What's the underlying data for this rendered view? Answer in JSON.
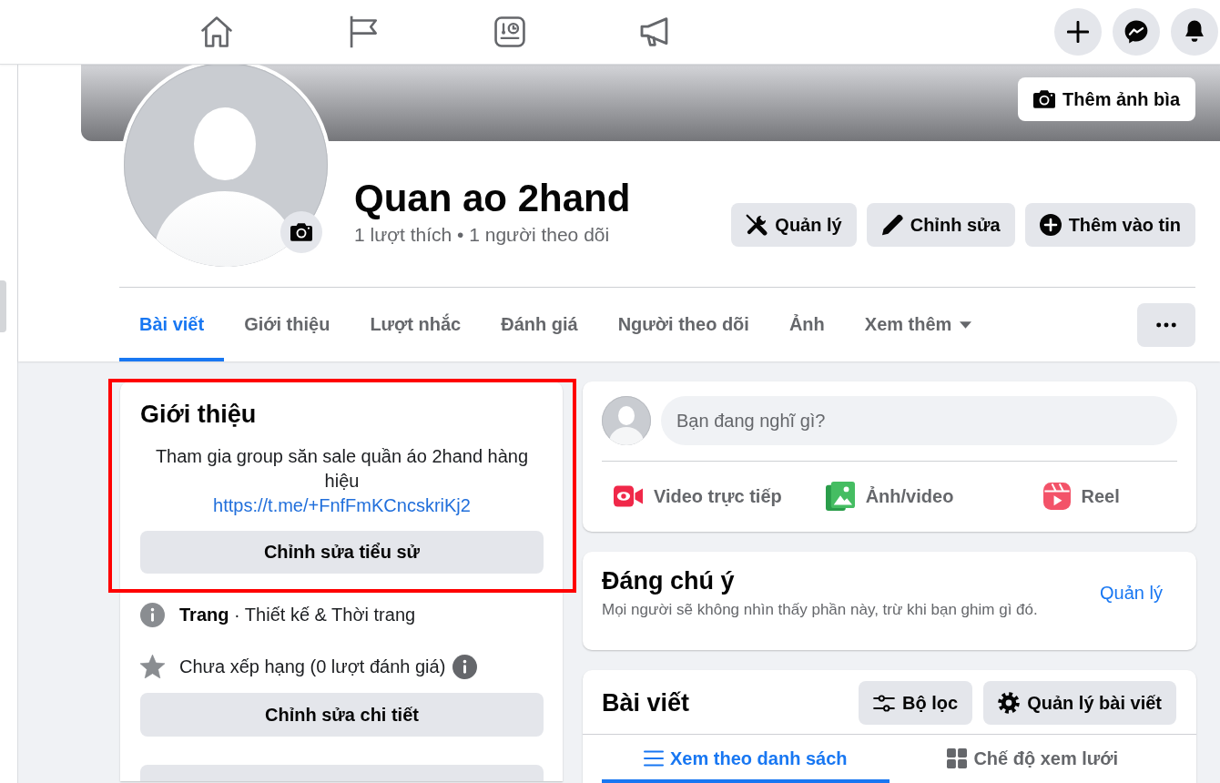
{
  "cover": {
    "add_cover_button": "Thêm ảnh bìa"
  },
  "page": {
    "name": "Quan ao 2hand",
    "stats": "1 lượt thích • 1 người theo dõi",
    "actions": [
      {
        "kind": "manage",
        "label": "Quản lý"
      },
      {
        "kind": "edit",
        "label": "Chỉnh sửa"
      },
      {
        "kind": "story",
        "label": "Thêm vào tin"
      }
    ]
  },
  "tabs": [
    {
      "kind": "tab",
      "label": "Bài viết",
      "selected": true
    },
    {
      "kind": "tab",
      "label": "Giới thiệu",
      "selected": false
    },
    {
      "kind": "tab",
      "label": "Lượt nhắc",
      "selected": false
    },
    {
      "kind": "tab",
      "label": "Đánh giá",
      "selected": false
    },
    {
      "kind": "tab",
      "label": "Người theo dõi",
      "selected": false
    },
    {
      "kind": "tab",
      "label": "Ảnh",
      "selected": false
    },
    {
      "kind": "dropdown",
      "label": "Xem thêm",
      "selected": false
    }
  ],
  "intro": {
    "highlighted": true,
    "title": "Giới thiệu",
    "bio": "Tham gia group săn sale quần áo 2hand hàng hiệu",
    "link": "https://t.me/+FnfFmKCncskriKj2",
    "edit_bio_button": "Chỉnh sửa tiểu sử",
    "details": [
      {
        "kind": "category",
        "text": "**Trang** · Thiết kế & Thời trang"
      },
      {
        "kind": "rating",
        "text": "Chưa xếp hạng (0 lượt đánh giá)"
      }
    ],
    "edit_details_button": "Chỉnh sửa chi tiết"
  },
  "composer": {
    "placeholder": "Bạn đang nghĩ gì?",
    "actions": [
      {
        "kind": "live",
        "label": "Video trực tiếp"
      },
      {
        "kind": "photo",
        "label": "Ảnh/video"
      },
      {
        "kind": "reel",
        "label": "Reel"
      }
    ]
  },
  "featured": {
    "title": "Đáng chú ý",
    "description": "Mọi người sẽ không nhìn thấy phần này, trừ khi bạn ghim gì đó.",
    "manage_link": "Quản lý"
  },
  "posts": {
    "title": "Bài viết",
    "buttons": [
      {
        "kind": "filter",
        "label": "Bộ lọc"
      },
      {
        "kind": "manage",
        "label": "Quản lý bài viết"
      }
    ],
    "views": [
      {
        "kind": "list",
        "label": "Xem theo danh sách",
        "selected": true
      },
      {
        "kind": "grid",
        "label": "Chế độ xem lưới",
        "selected": false
      }
    ]
  }
}
